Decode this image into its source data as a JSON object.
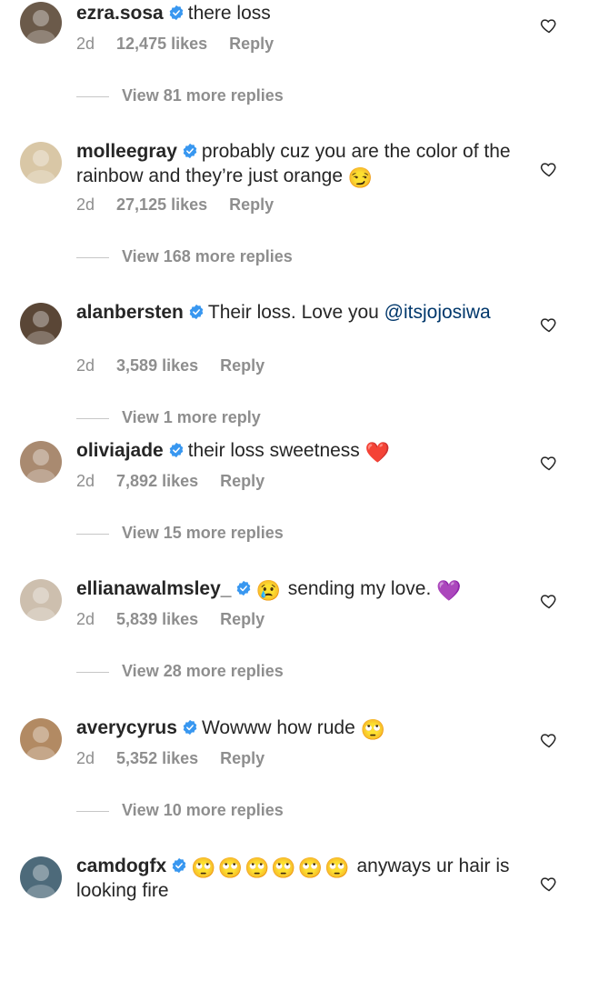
{
  "comments": [
    {
      "username": "ezra.sosa",
      "text_before": "there loss",
      "mention": "",
      "text_after": "",
      "emoji": [],
      "age": "2d",
      "likes": "12,475 likes",
      "reply": "Reply",
      "view_replies": "View 81 more replies",
      "avatar_color": "#6b5a4a"
    },
    {
      "username": "molleegray",
      "text_before": "probably cuz you are the color of the rainbow and they’re just orange",
      "mention": "",
      "text_after": "",
      "emoji": [
        "😏"
      ],
      "age": "2d",
      "likes": "27,125 likes",
      "reply": "Reply",
      "view_replies": "View 168 more replies",
      "avatar_color": "#d9c7a6"
    },
    {
      "username": "alanbersten",
      "text_before": "Their loss. Love you",
      "mention": "@itsjojosiwa",
      "text_after": "",
      "emoji": [],
      "age": "2d",
      "likes": "3,589 likes",
      "reply": "Reply",
      "view_replies": "View 1 more reply",
      "avatar_color": "#5a4636"
    },
    {
      "username": "oliviajade",
      "text_before": "their loss sweetness",
      "mention": "",
      "text_after": "",
      "emoji": [
        "❤️"
      ],
      "age": "2d",
      "likes": "7,892 likes",
      "reply": "Reply",
      "view_replies": "View 15 more replies",
      "avatar_color": "#a98a70"
    },
    {
      "username": "ellianawalmsley_",
      "text_before": "",
      "mention": "",
      "text_after": "sending my love.",
      "emoji": [
        "😢"
      ],
      "trailing_emoji": [
        "💜"
      ],
      "age": "2d",
      "likes": "5,839 likes",
      "reply": "Reply",
      "view_replies": "View 28 more replies",
      "avatar_color": "#cdbfae"
    },
    {
      "username": "averycyrus",
      "text_before": "Wowww how rude",
      "mention": "",
      "text_after": "",
      "emoji": [
        "🙄"
      ],
      "age": "2d",
      "likes": "5,352 likes",
      "reply": "Reply",
      "view_replies": "View 10 more replies",
      "avatar_color": "#b28a63"
    },
    {
      "username": "camdogfx",
      "text_before": "",
      "mention": "",
      "text_after": "anyways ur hair is looking fire",
      "emoji": [
        "🙄",
        "🙄",
        "🙄",
        "🙄",
        "🙄",
        "🙄"
      ],
      "age": "",
      "likes": "",
      "reply": "",
      "view_replies": "",
      "avatar_color": "#4d6a7a"
    }
  ]
}
